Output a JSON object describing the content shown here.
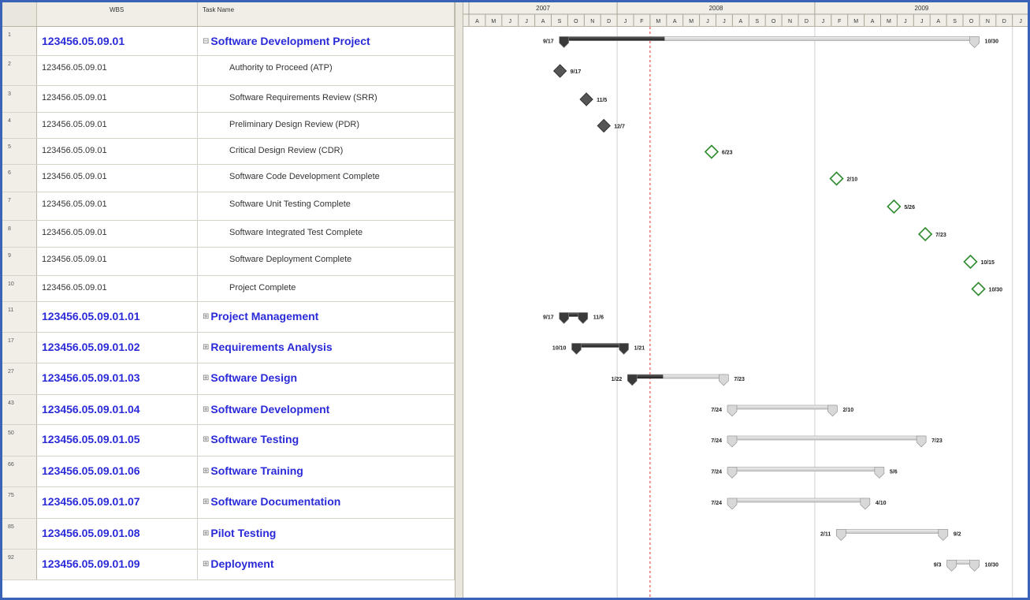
{
  "columns": {
    "wbs": "WBS",
    "task_name": "Task Name"
  },
  "timescale": {
    "years": [
      "2007",
      "2008",
      "2009"
    ],
    "months": [
      "A",
      "M",
      "J",
      "J",
      "A",
      "S",
      "O",
      "N",
      "D",
      "J",
      "F",
      "M",
      "A",
      "M",
      "J",
      "J",
      "A",
      "S",
      "O",
      "N",
      "D",
      "J",
      "F",
      "M",
      "A",
      "M",
      "J",
      "J",
      "A",
      "S",
      "O",
      "N",
      "D",
      "J"
    ]
  },
  "rows": [
    {
      "id": "1",
      "wbs": "123456.05.09.01",
      "name": "Software Development Project",
      "level": "summary"
    },
    {
      "id": "2",
      "wbs": "123456.05.09.01",
      "name": "Authority to Proceed  (ATP)",
      "level": "task"
    },
    {
      "id": "3",
      "wbs": "123456.05.09.01",
      "name": "Software Requirements Review (SRR)",
      "level": "task"
    },
    {
      "id": "4",
      "wbs": "123456.05.09.01",
      "name": "Preliminary Design Review (PDR)",
      "level": "task"
    },
    {
      "id": "5",
      "wbs": "123456.05.09.01",
      "name": "Critical Design Review (CDR)",
      "level": "task"
    },
    {
      "id": "6",
      "wbs": "123456.05.09.01",
      "name": "Software Code Development Complete",
      "level": "task"
    },
    {
      "id": "7",
      "wbs": "123456.05.09.01",
      "name": "Software Unit Testing Complete",
      "level": "task"
    },
    {
      "id": "8",
      "wbs": "123456.05.09.01",
      "name": "Software Integrated Test Complete",
      "level": "task"
    },
    {
      "id": "9",
      "wbs": "123456.05.09.01",
      "name": "Software Deployment Complete",
      "level": "task"
    },
    {
      "id": "10",
      "wbs": "123456.05.09.01",
      "name": "Project Complete",
      "level": "task"
    },
    {
      "id": "11",
      "wbs": "123456.05.09.01.01",
      "name": "Project Management",
      "level": "group"
    },
    {
      "id": "17",
      "wbs": "123456.05.09.01.02",
      "name": "Requirements Analysis",
      "level": "group"
    },
    {
      "id": "27",
      "wbs": "123456.05.09.01.03",
      "name": "Software Design",
      "level": "group"
    },
    {
      "id": "43",
      "wbs": "123456.05.09.01.04",
      "name": "Software Development",
      "level": "group"
    },
    {
      "id": "50",
      "wbs": "123456.05.09.01.05",
      "name": "Software Testing",
      "level": "group"
    },
    {
      "id": "66",
      "wbs": "123456.05.09.01.06",
      "name": "Software Training",
      "level": "group"
    },
    {
      "id": "75",
      "wbs": "123456.05.09.01.07",
      "name": "Software Documentation",
      "level": "group"
    },
    {
      "id": "85",
      "wbs": "123456.05.09.01.08",
      "name": "Pilot Testing",
      "level": "group"
    },
    {
      "id": "92",
      "wbs": "123456.05.09.01.09",
      "name": "Deployment",
      "level": "group"
    }
  ],
  "gantt": {
    "status_date": "2008-03-01",
    "items": [
      {
        "row": 0,
        "kind": "summary",
        "start": "2007-09-17",
        "end": "2009-10-30",
        "start_label": "9/17",
        "end_label": "10/30",
        "progress": 0.25
      },
      {
        "row": 1,
        "kind": "milestone",
        "date": "2007-09-17",
        "label": "9/17",
        "done": true
      },
      {
        "row": 2,
        "kind": "milestone",
        "date": "2007-11-05",
        "label": "11/5",
        "done": true
      },
      {
        "row": 3,
        "kind": "milestone",
        "date": "2007-12-07",
        "label": "12/7",
        "done": true
      },
      {
        "row": 4,
        "kind": "milestone",
        "date": "2008-06-23",
        "label": "6/23",
        "done": false
      },
      {
        "row": 5,
        "kind": "milestone",
        "date": "2009-02-10",
        "label": "2/10",
        "done": false
      },
      {
        "row": 6,
        "kind": "milestone",
        "date": "2009-05-26",
        "label": "5/26",
        "done": false
      },
      {
        "row": 7,
        "kind": "milestone",
        "date": "2009-07-23",
        "label": "7/23",
        "done": false
      },
      {
        "row": 8,
        "kind": "milestone",
        "date": "2009-10-15",
        "label": "10/15",
        "done": false
      },
      {
        "row": 9,
        "kind": "milestone",
        "date": "2009-10-30",
        "label": "10/30",
        "done": false
      },
      {
        "row": 10,
        "kind": "summary",
        "start": "2007-09-17",
        "end": "2007-11-06",
        "start_label": "9/17",
        "end_label": "11/6",
        "progress": 1.0
      },
      {
        "row": 11,
        "kind": "summary",
        "start": "2007-10-10",
        "end": "2008-01-21",
        "start_label": "10/10",
        "end_label": "1/21",
        "progress": 1.0
      },
      {
        "row": 12,
        "kind": "summary",
        "start": "2008-01-22",
        "end": "2008-07-23",
        "start_label": "1/22",
        "end_label": "7/23",
        "progress": 0.35
      },
      {
        "row": 13,
        "kind": "summary",
        "start": "2008-07-24",
        "end": "2009-02-10",
        "start_label": "7/24",
        "end_label": "2/10",
        "progress": 0
      },
      {
        "row": 14,
        "kind": "summary",
        "start": "2008-07-24",
        "end": "2009-07-23",
        "start_label": "7/24",
        "end_label": "7/23",
        "progress": 0
      },
      {
        "row": 15,
        "kind": "summary",
        "start": "2008-07-24",
        "end": "2009-05-06",
        "start_label": "7/24",
        "end_label": "5/6",
        "progress": 0
      },
      {
        "row": 16,
        "kind": "summary",
        "start": "2008-07-24",
        "end": "2009-04-10",
        "start_label": "7/24",
        "end_label": "4/10",
        "progress": 0
      },
      {
        "row": 17,
        "kind": "summary",
        "start": "2009-02-11",
        "end": "2009-09-02",
        "start_label": "2/11",
        "end_label": "9/2",
        "progress": 0
      },
      {
        "row": 18,
        "kind": "summary",
        "start": "2009-09-03",
        "end": "2009-10-30",
        "start_label": "9/3",
        "end_label": "10/30",
        "progress": 0
      }
    ]
  },
  "colors": {
    "summary_text": "#2a2ad8",
    "milestone_done": "#555555",
    "milestone_open": "#2e8b2e",
    "status_line": "#e03030",
    "bar_done": "#3a3a3a",
    "bar_open": "#d6d6d6",
    "frame": "#3a63b8"
  }
}
